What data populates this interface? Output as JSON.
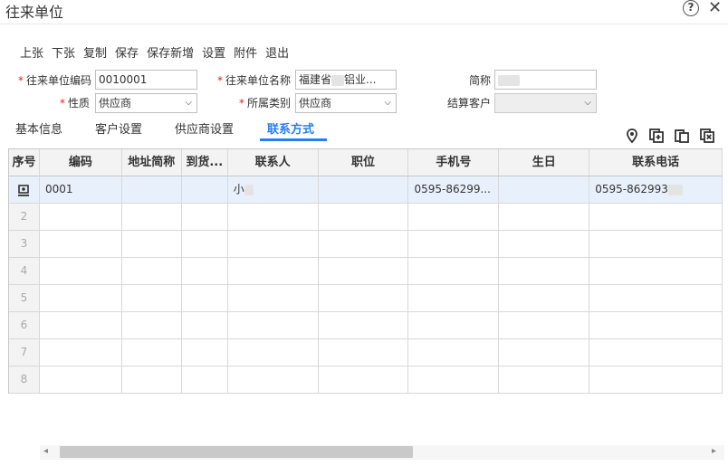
{
  "window": {
    "title": "往来单位",
    "help_glyph": "?",
    "close_glyph": "✕"
  },
  "toolbar": [
    "上张",
    "下张",
    "复制",
    "保存",
    "保存新增",
    "设置",
    "附件",
    "退出"
  ],
  "form": {
    "code_label": "往来单位编码",
    "code_value": "0010001",
    "name_label": "往来单位名称",
    "name_value_prefix": "福建省",
    "name_value_suffix": "铝业...",
    "short_label": "简称",
    "nature_label": "性质",
    "nature_value": "供应商",
    "category_label": "所属类别",
    "category_value": "供应商",
    "settle_label": "结算客户",
    "settle_value": "",
    "required_mark": "*"
  },
  "tabs": [
    {
      "label": "基本信息",
      "active": false
    },
    {
      "label": "客户设置",
      "active": false
    },
    {
      "label": "供应商设置",
      "active": false
    },
    {
      "label": "联系方式",
      "active": true
    }
  ],
  "action_icons": [
    "location-pin-icon",
    "add-row-icon",
    "copy-row-icon",
    "delete-row-icon"
  ],
  "grid": {
    "columns": [
      "序号",
      "编码",
      "地址简称",
      "到货...",
      "联系人",
      "职位",
      "手机号",
      "生日",
      "联系电话"
    ],
    "row_glyph": "⯐",
    "rows": [
      {
        "index": "",
        "code": "0001",
        "address": "",
        "arrival": "",
        "contact": "小",
        "position": "",
        "mobile": "0595-86299...",
        "birthday": "",
        "phone": "0595-862993"
      },
      {
        "index": "2",
        "code": "",
        "address": "",
        "arrival": "",
        "contact": "",
        "position": "",
        "mobile": "",
        "birthday": "",
        "phone": ""
      },
      {
        "index": "3",
        "code": "",
        "address": "",
        "arrival": "",
        "contact": "",
        "position": "",
        "mobile": "",
        "birthday": "",
        "phone": ""
      },
      {
        "index": "4",
        "code": "",
        "address": "",
        "arrival": "",
        "contact": "",
        "position": "",
        "mobile": "",
        "birthday": "",
        "phone": ""
      },
      {
        "index": "5",
        "code": "",
        "address": "",
        "arrival": "",
        "contact": "",
        "position": "",
        "mobile": "",
        "birthday": "",
        "phone": ""
      },
      {
        "index": "6",
        "code": "",
        "address": "",
        "arrival": "",
        "contact": "",
        "position": "",
        "mobile": "",
        "birthday": "",
        "phone": ""
      },
      {
        "index": "7",
        "code": "",
        "address": "",
        "arrival": "",
        "contact": "",
        "position": "",
        "mobile": "",
        "birthday": "",
        "phone": ""
      },
      {
        "index": "8",
        "code": "",
        "address": "",
        "arrival": "",
        "contact": "",
        "position": "",
        "mobile": "",
        "birthday": "",
        "phone": ""
      }
    ]
  },
  "scrollbar": {
    "left_arrow": "◂",
    "right_arrow": "▸",
    "thumb_fraction": 0.52
  },
  "colors": {
    "accent": "#2b7de9",
    "required": "#e02020",
    "selected_row": "#e8f1fb"
  }
}
